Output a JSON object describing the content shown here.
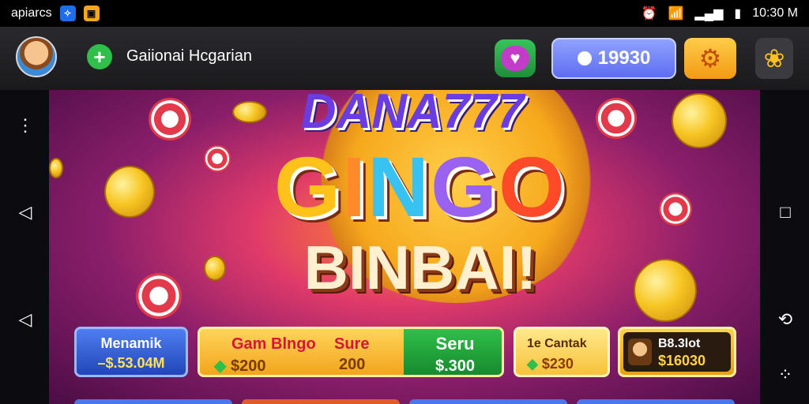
{
  "status_bar": {
    "app_text": "apiarcs",
    "icon1": "✧",
    "icon2": "▣",
    "time": "10:30 M"
  },
  "top_bar": {
    "username": "Gaiionai Hcgarian",
    "coins": "19930",
    "add_icon": "+",
    "heart_icon": "♥",
    "gear_icon": "⚙",
    "flower_gear_icon": "❀"
  },
  "logo": {
    "line1": "DANA777",
    "line2": [
      "G",
      "I",
      "N",
      "G",
      "O"
    ],
    "line3": "BINBAI!"
  },
  "cards": {
    "menarik": {
      "title": "Menamik",
      "value": "–$.53.04M"
    },
    "bingo": {
      "title1": "Gam Blngo",
      "title2": "Sure",
      "prize1": "$200",
      "prize2": "200"
    },
    "seru": {
      "title": "Seru",
      "value": "$.300"
    },
    "cantar": {
      "title": "1e Cantak",
      "value": "$230"
    },
    "slot": {
      "title": "B8.3lot",
      "value": "$16030"
    }
  },
  "colors": {
    "accent_purple": "#6a3de2",
    "gold": "#f7c623",
    "green": "#2fbf4a",
    "blue": "#5e6df0"
  }
}
